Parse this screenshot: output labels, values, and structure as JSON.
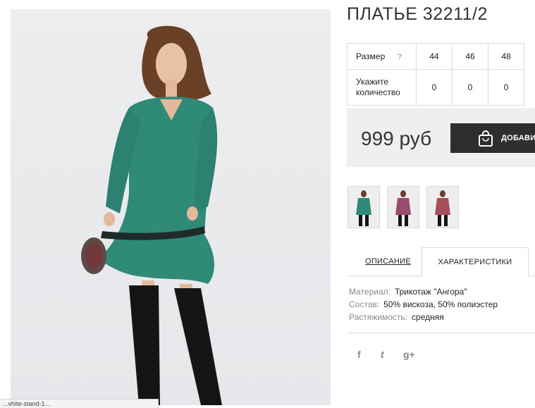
{
  "product": {
    "title": "ПЛАТЬЕ 32211/2",
    "price": "999 руб",
    "add_label": "ДОБАВИТЬ"
  },
  "size_table": {
    "size_label": "Размер",
    "help_icon": "?",
    "qty_label": "Укажите количество",
    "sizes": [
      "44",
      "46",
      "48"
    ],
    "quantities": [
      "0",
      "0",
      "0"
    ]
  },
  "thumbnails": [
    {
      "color": "#2f8a78"
    },
    {
      "color": "#9a4c6e"
    },
    {
      "color": "#a84e5a"
    }
  ],
  "tabs": {
    "description": "ОПИСАНИЕ",
    "characteristics": "ХАРАКТЕРИСТИКИ"
  },
  "specs": [
    {
      "key": "Материал:",
      "value": "Трикотаж \"Ангора\""
    },
    {
      "key": "Состав:",
      "value": "50% вискоза, 50% полиэстер"
    },
    {
      "key": "Растяжимость:",
      "value": "средняя"
    }
  ],
  "social": {
    "facebook": "f",
    "twitter": "t",
    "gplus": "g+"
  },
  "status_bar": "...vhite-stand-1...",
  "colors": {
    "dress": "#2f8a78",
    "button": "#2e2e2e",
    "price_bg": "#efefef"
  }
}
